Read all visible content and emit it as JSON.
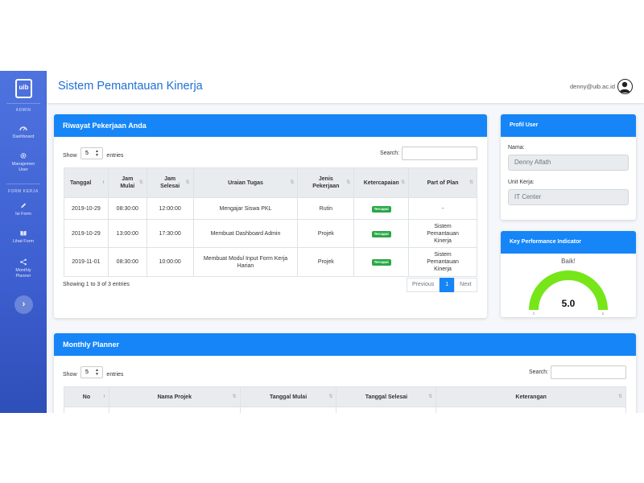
{
  "sidebar": {
    "logo": "uib",
    "sections": [
      {
        "heading": "ADMIN"
      },
      {
        "heading": "FORM KERJA"
      }
    ],
    "items": [
      {
        "label": "Dashboard",
        "icon": "dashboard-icon"
      },
      {
        "label": "Manajemen User",
        "icon": "gear-icon"
      },
      {
        "label": "Isi Form",
        "icon": "pencil-icon"
      },
      {
        "label": "Lihat Form",
        "icon": "book-icon"
      },
      {
        "label": "Monthly Planner",
        "icon": "share-icon"
      }
    ],
    "toggle_icon": "chevron-right-icon"
  },
  "topbar": {
    "title": "Sistem Pemantauan Kinerja",
    "user_email": "denny@uib.ac.id",
    "avatar_icon": "user-circle-icon"
  },
  "riwayat": {
    "title": "Riwayat Pekerjaan Anda",
    "show_label": "Show",
    "entries_value": "5",
    "entries_label": "entries",
    "search_label": "Search:",
    "columns": [
      "Tanggal",
      "Jam Mulai",
      "Jam Selesai",
      "Uraian Tugas",
      "Jenis Pekerjaan",
      "Ketercapaian",
      "Part of Plan"
    ],
    "rows": [
      {
        "tanggal": "2019-10-29",
        "mulai": "08:30:00",
        "selesai": "12:00:00",
        "uraian": "Mengajar Siswa PKL",
        "jenis": "Rutin",
        "ketercapaian": "Tercapai",
        "plan": "-"
      },
      {
        "tanggal": "2019-10-29",
        "mulai": "13:00:00",
        "selesai": "17:30:00",
        "uraian": "Membuat Dashboard Admin",
        "jenis": "Projek",
        "ketercapaian": "Tercapai",
        "plan": "Sistem Pemantauan Kinerja"
      },
      {
        "tanggal": "2019-11-01",
        "mulai": "08:30:00",
        "selesai": "10:00:00",
        "uraian": "Membuat Modul Input Form Kerja Harian",
        "jenis": "Projek",
        "ketercapaian": "Tercapai",
        "plan": "Sistem Pemantauan Kinerja"
      }
    ],
    "info": "Showing 1 to 3 of 3 entries",
    "pagination": {
      "previous": "Previous",
      "page": "1",
      "next": "Next"
    }
  },
  "profil": {
    "title": "Profil User",
    "nama_label": "Nama:",
    "nama_value": "Denny Alfath",
    "unit_label": "Unit Kerja:",
    "unit_value": "IT Center"
  },
  "kpi": {
    "title": "Key Performance Indicator",
    "status": "Baik!",
    "value": 5.0,
    "value_text": "5.0",
    "min": "0",
    "max": "5",
    "gauge_color": "#76e619"
  },
  "planner": {
    "title": "Monthly Planner",
    "show_label": "Show",
    "entries_value": "5",
    "entries_label": "entries",
    "search_label": "Search:",
    "columns": [
      "No",
      "Nama Projek",
      "Tanggal Mulai",
      "Tanggal Selesai",
      "Keterangan"
    ]
  },
  "colors": {
    "primary": "#1585f7",
    "sidebar": "#4e73df",
    "badge": "#28a745"
  }
}
